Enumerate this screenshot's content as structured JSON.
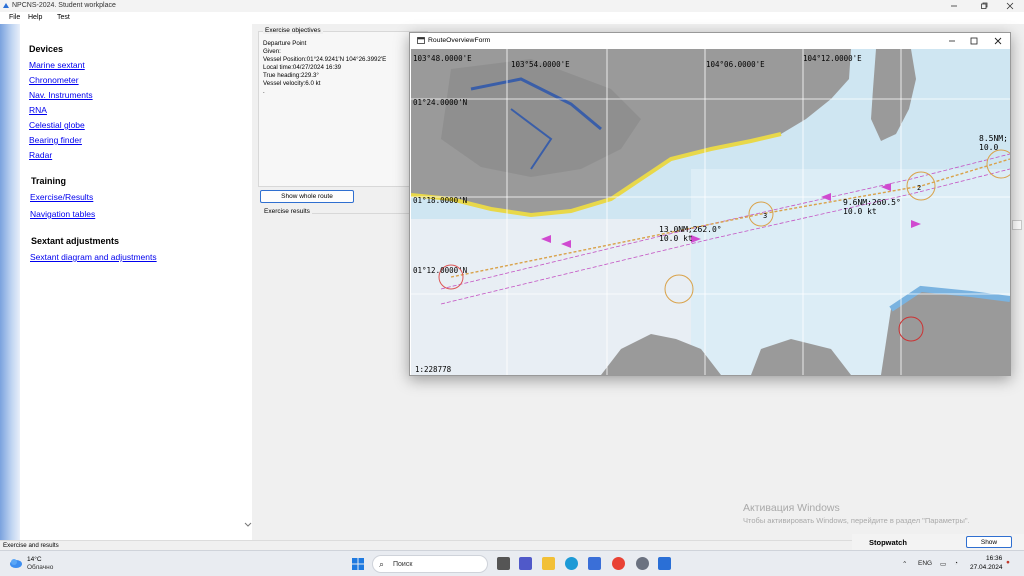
{
  "window": {
    "title": "NPCNS-2024. Student workplace",
    "menu": [
      "File",
      "Help",
      "Test"
    ]
  },
  "nav": {
    "devices_heading": "Devices",
    "devices": [
      "Marine sextant",
      "Chronometer",
      "Nav. Instruments",
      "RNA",
      "Celestial globe",
      "Bearing finder",
      "Radar"
    ],
    "training_heading": "Training",
    "training": [
      "Exercise/Results",
      "Navigation tables"
    ],
    "sextant_heading": "Sextant adjustments",
    "sextant": [
      "Sextant diagram and adjustments"
    ]
  },
  "objectives": {
    "label": "Exercise objectives",
    "lines": [
      "Departure Point",
      "Given:",
      "Vessel Position:01°24.9241'N 104°26.3992'E",
      "Local time:04/27/2024 16:39",
      "True heading:229.3°",
      "Vessel velocity:6.0 kt",
      "."
    ]
  },
  "show_route_label": "Show whole route",
  "results_label": "Exercise results",
  "route_window": {
    "title": "RouteOverviewForm",
    "coords": {
      "lon_1": "103°48.0000'E",
      "lon_2": "103°54.0000'E",
      "lon_3": "104°06.0000'E",
      "lon_4": "104°12.0000'E",
      "lat_1": "01°24.0000'N",
      "lat_2": "01°18.0000'N",
      "lat_3": "01°12.0000'N"
    },
    "legs": [
      {
        "distance": "13.0NM;262.0°",
        "speed": "10.0 kt"
      },
      {
        "distance": "9.6NM;260.5°",
        "speed": "10.0 kt"
      },
      {
        "distance": "8.5NM;",
        "speed": "10.0"
      }
    ],
    "waypoints": [
      "2",
      "3"
    ],
    "scale": "1:228778"
  },
  "activation": {
    "title": "Активация Windows",
    "subtitle": "Чтобы активировать Windows, перейдите в раздел \"Параметры\"."
  },
  "status_text": "Exercise and results",
  "stopwatch": {
    "label": "Stopwatch",
    "button": "Show"
  },
  "taskbar": {
    "weather_temp": "14°C",
    "weather_cond": "Облачно",
    "search_placeholder": "Поиск",
    "lang": "ENG",
    "time": "16:36",
    "date": "27.04.2024"
  }
}
